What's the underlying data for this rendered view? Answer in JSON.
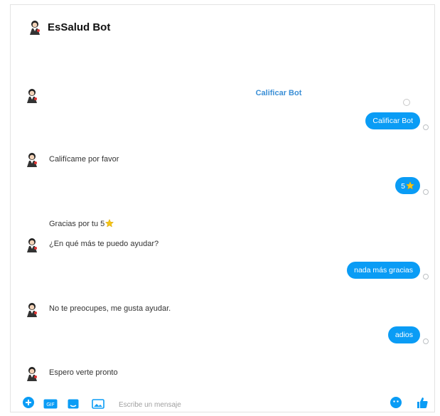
{
  "app": {
    "title": "EsSalud Bot"
  },
  "rate_link": "Calificar Bot",
  "messages": {
    "user_1": "Calificar Bot",
    "bot_1": "Califícame por favor",
    "user_2": "5",
    "bot_2a": "Gracias por tu 5",
    "bot_2b": "¿En qué más te puedo ayudar?",
    "user_3": "nada más gracias",
    "bot_3": "No te preocupes, me gusta ayudar.",
    "user_4": "adios",
    "bot_4": "Espero verte pronto"
  },
  "composer": {
    "placeholder": "Escribe un mensaje"
  },
  "colors": {
    "bubble": "#0a9cf5",
    "link": "#3b8fd6",
    "star": "#f5c518",
    "tool": "#0a9cf5"
  },
  "icons": [
    "bot-avatar-icon",
    "star-icon",
    "plus-icon",
    "gif-icon",
    "sticker-icon",
    "image-icon",
    "emoji-icon",
    "like-icon"
  ]
}
